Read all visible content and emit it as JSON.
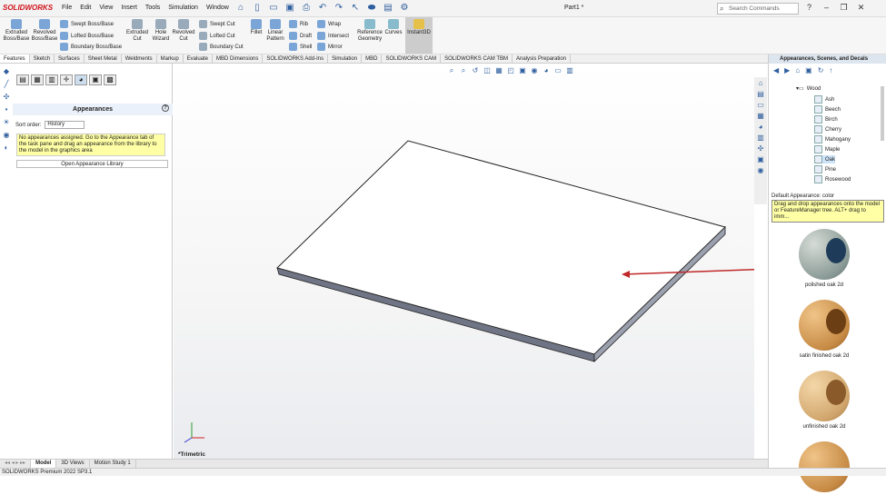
{
  "brand": "SOLIDWORKS",
  "menus": [
    "File",
    "Edit",
    "View",
    "Insert",
    "Tools",
    "Simulation",
    "Window"
  ],
  "doc_title": "Part1 *",
  "search_placeholder": "Search Commands",
  "ribbon": {
    "extruded_boss": "Extruded Boss/Base",
    "revolved_boss": "Revolved Boss/Base",
    "swept_boss": "Swept Boss/Base",
    "lofted_boss": "Lofted Boss/Base",
    "boundary_boss": "Boundary Boss/Base",
    "extruded_cut": "Extruded Cut",
    "hole_wizard": "Hole Wizard",
    "revolved_cut": "Revolved Cut",
    "swept_cut": "Swept Cut",
    "lofted_cut": "Lofted Cut",
    "boundary_cut": "Boundary Cut",
    "fillet": "Fillet",
    "linear_pattern": "Linear Pattern",
    "rib": "Rib",
    "draft": "Draft",
    "shell": "Shell",
    "wrap": "Wrap",
    "intersect": "Intersect",
    "mirror": "Mirror",
    "reference_geometry": "Reference Geometry",
    "curves": "Curves",
    "instant3d": "Instant3D"
  },
  "tabs": [
    "Features",
    "Sketch",
    "Surfaces",
    "Sheet Metal",
    "Weldments",
    "Markup",
    "Evaluate",
    "MBD Dimensions",
    "SOLIDWORKS Add-Ins",
    "Simulation",
    "MBD",
    "SOLIDWORKS CAM",
    "SOLIDWORKS CAM TBM",
    "Analysis Preparation"
  ],
  "panel": {
    "title": "Appearances",
    "sort_label": "Sort order:",
    "sort_value": "History",
    "message": "No appearances assigned. Go to the Appearance tab of the task pane and drag an appearance from the library to the model in the graphics area",
    "open_library": "Open Appearance Library"
  },
  "graphics": {
    "view_label": "*Trimetric"
  },
  "right_panel": {
    "title": "Appearances, Scenes, and Decals",
    "folder": "Wood",
    "items": [
      "Ash",
      "Beech",
      "Birch",
      "Cherry",
      "Mahogany",
      "Maple",
      "Oak",
      "Pine",
      "Rosewood"
    ],
    "selected": "Oak",
    "default_appearance": "Default Appearance: color",
    "tip": "Drag and drop appearances onto the model or FeatureManager tree.  ALT+ drag to imm...",
    "thumbnails": [
      "polished oak 2d",
      "satin finished oak 2d",
      "unfinished oak 2d"
    ]
  },
  "bottom_tabs": [
    "Model",
    "3D Views",
    "Motion Study 1"
  ],
  "status": "SOLIDWORKS Premium 2022 SP3.1",
  "colors": {
    "brand": "#d0121b",
    "arrow": "#c0282a",
    "accent": "#2f5f9e"
  }
}
